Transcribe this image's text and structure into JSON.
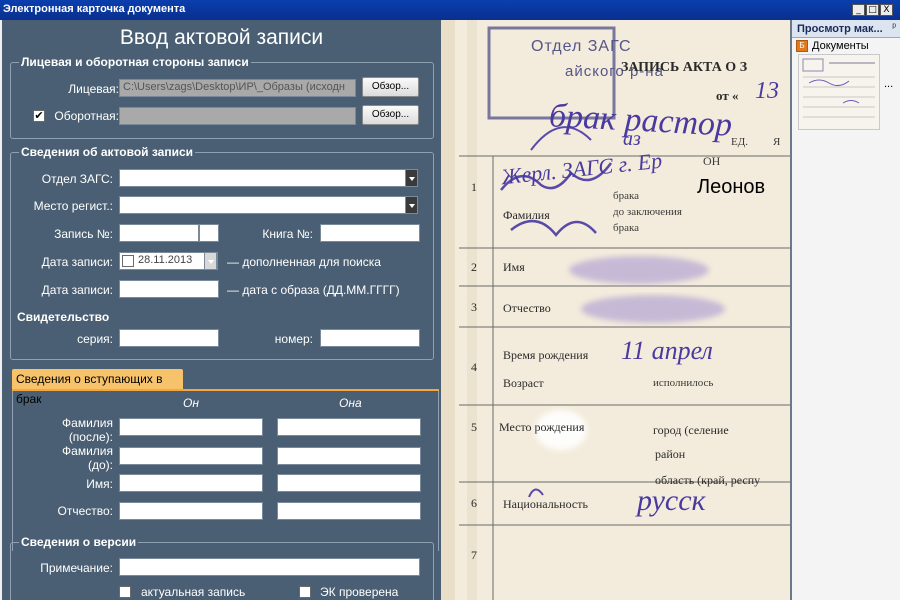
{
  "window": {
    "title": "Электронная карточка документа",
    "controls": [
      "_",
      "□",
      "X"
    ]
  },
  "form": {
    "heading": "Ввод актовой записи",
    "sides_group": {
      "title": "Лицевая и оборотная стороны записи",
      "front_label": "Лицевая:",
      "front_value": "C:\\Users\\zags\\Desktop\\ИР\\_Образы (исходн",
      "front_browse": "Обзор...",
      "back_checked": true,
      "back_label": "Оборотная:",
      "back_value": "",
      "back_browse": "Обзор..."
    },
    "record_group": {
      "title": "Сведения об актовой записи",
      "office_label": "Отдел ЗАГС:",
      "office_value": "",
      "place_label": "Место регист.:",
      "place_value": "",
      "record_no_label": "Запись №:",
      "record_no_value": "",
      "book_no_label": "Книга №:",
      "book_no_value": "",
      "date1_label": "Дата записи:",
      "date1_value": "28.11.2013",
      "date1_note": "— дополненная для поиска",
      "date2_label": "Дата записи:",
      "date2_value": "",
      "date2_note": "— дата с образа (ДД.ММ.ГГГГ)",
      "certificate_label": "Свидетельство",
      "series_label": "серия:",
      "series_value": "",
      "number_label": "номер:",
      "number_value": ""
    },
    "marriage_tab": {
      "label": "Сведения о вступающих в брак",
      "he": "Он",
      "she": "Она",
      "surname_after_label": "Фамилия (после):",
      "surname_before_label": "Фамилия (до):",
      "name_label": "Имя:",
      "patronymic_label": "Отчество:"
    },
    "version_group": {
      "title": "Сведения о версии",
      "note_label": "Примечание:",
      "note_value": "",
      "actual_label": "актуальная запись",
      "checked_label": "ЭК проверена"
    }
  },
  "document": {
    "stamp_line1": "Отдел ЗАГС",
    "stamp_line2": "айского р-на",
    "header": "ЗАПИСЬ АКТА О З",
    "date_prefix": "от «",
    "date_day": "13",
    "hw_divorce": "брак растор",
    "row_labels": [
      "Фамилия",
      "Имя",
      "Отчество",
      "Время рождения",
      "Возраст",
      "Место рождения",
      "Национальность"
    ],
    "row_numbers": [
      "1",
      "2",
      "3",
      "4",
      "5",
      "6",
      "7"
    ],
    "printed_on": "ОН",
    "printed_ed": "ЕД.",
    "printed_ya": "Я",
    "printed_brak": "брака",
    "printed_do_zakl": "до заключения",
    "printed_brak2": "брака",
    "surname_typed": "Леонов",
    "hw_birth": "11 апрел",
    "printed_age": "исполнилось",
    "printed_city": "город (селение",
    "printed_district": "район",
    "printed_region": "область (край, респу",
    "hw_nationality": "русск",
    "hw_az": "аз",
    "hw_stamp_note": "Жерл. ЗАГС г. Ер"
  },
  "side_panel": {
    "title": "Просмотр мак...",
    "pin": "ᵖ",
    "tree_item": "Документы",
    "ellipsis": "..."
  }
}
